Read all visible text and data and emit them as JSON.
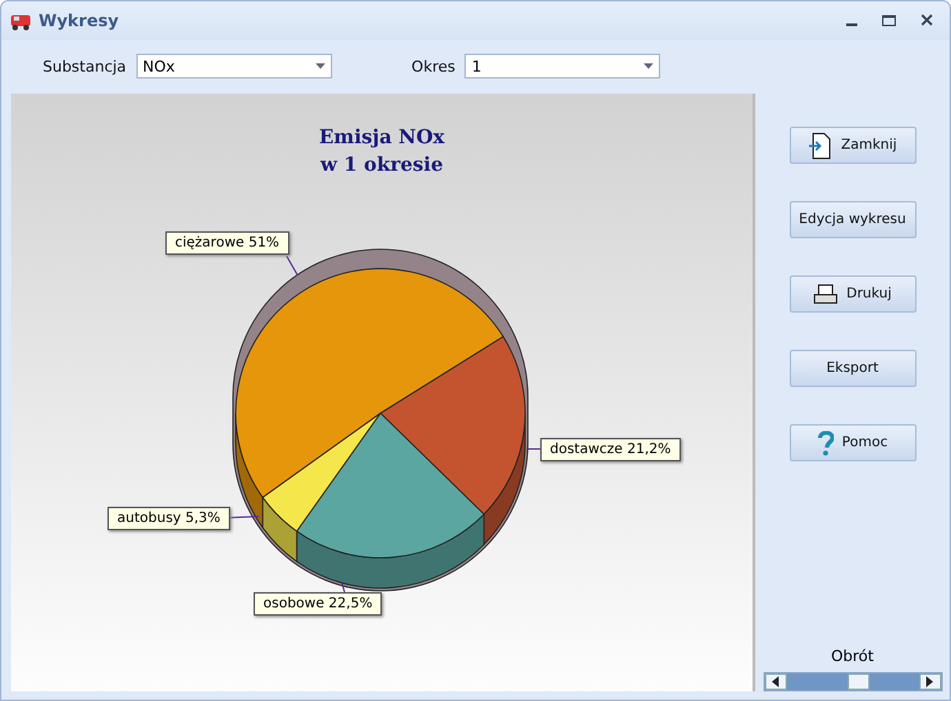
{
  "window": {
    "title": "Wykresy"
  },
  "filters": [
    {
      "label": "Substancja",
      "value": "NOx"
    },
    {
      "label": "Okres",
      "value": "1"
    }
  ],
  "chart": {
    "chart_data": {
      "type": "pie",
      "title": "Emisja NOx\nw 1 okresie",
      "categories": [
        "dostawcze",
        "osobowe",
        "autobusy",
        "ciężarowe"
      ],
      "values": [
        21.2,
        22.5,
        5.3,
        51
      ],
      "colors": [
        "#c45430",
        "#5ba6a0",
        "#f5e64b",
        "#e6960a"
      ],
      "value_labels": [
        "21,2%",
        "22,5%",
        "5,3%",
        "51%"
      ]
    }
  },
  "buttons": [
    {
      "label": "Zamknij",
      "kind": "exit"
    },
    {
      "label": "Edycja wykresu",
      "kind": "plain"
    },
    {
      "label": "Drukuj",
      "kind": "printer"
    },
    {
      "label": "Eksport",
      "kind": "plain"
    },
    {
      "label": "Pomoc",
      "kind": "help"
    }
  ],
  "rotation": {
    "label": "Obrót",
    "level": 0.55
  }
}
